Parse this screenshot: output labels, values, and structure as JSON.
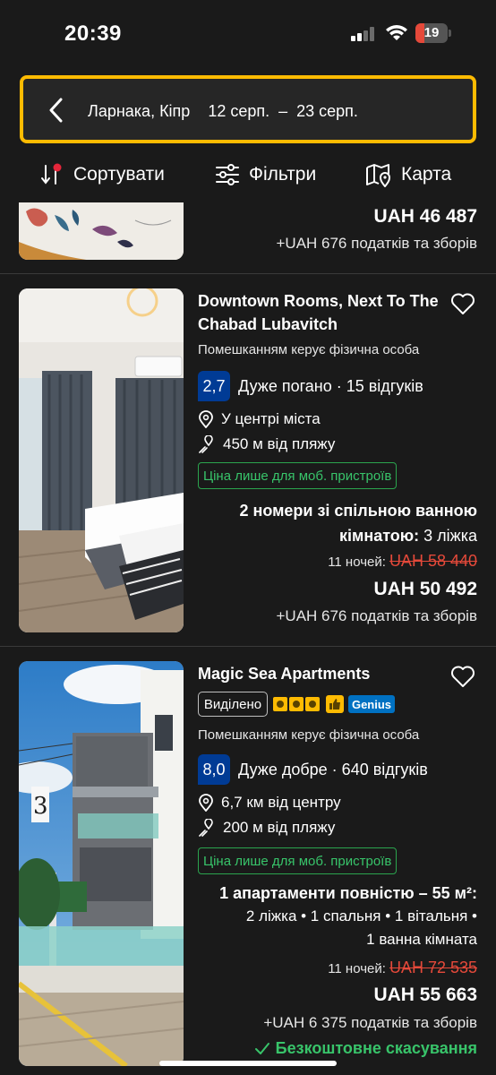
{
  "status": {
    "time": "20:39",
    "battery": "19"
  },
  "search": {
    "destination": "Ларнака, Кіпр",
    "dates": "12 серп.  –  23 серп."
  },
  "toolbar": {
    "sort": "Сортувати",
    "filters": "Фільтри",
    "map": "Карта"
  },
  "card0": {
    "price": "UAH 46 487",
    "taxes": "+UAH 676 податків та зборів"
  },
  "card1": {
    "title_line1": "Downtown Rooms, Next To The",
    "title_line2": "Chabad Lubavitch",
    "managed": "Помешканням керує фізична особа",
    "score": "2,7",
    "score_text": "Дуже погано · 15 відгуків",
    "location": "У центрі міста",
    "beach": "450 м від пляжу",
    "mobile_badge": "Ціна лише для моб. пристроїв",
    "room_line1": "2 номери зі спільною ванною",
    "room_line2_bold": "кімнатою:",
    "room_line2_normal": " 3 ліжка",
    "nights": "11 ночей:",
    "old_price": "UAH 58 440",
    "price": "UAH 50 492",
    "taxes": "+UAH 676 податків та зборів"
  },
  "card2": {
    "title": "Magic Sea Apartments",
    "featured": "Виділено",
    "genius": "Genius",
    "managed": "Помешканням керує фізична особа",
    "score": "8,0",
    "score_text": "Дуже добре · 640 відгуків",
    "location": "6,7 км від центру",
    "beach": "200 м від пляжу",
    "mobile_badge": "Ціна лише для моб. пристроїв",
    "room_line1": "1 апартаменти повністю – 55 м²:",
    "room_line2": "2 ліжка • 1 спальня • 1 вітальня •",
    "room_line3": "1 ванна кімната",
    "nights": "11 ночей:",
    "old_price": "UAH 72 535",
    "price": "UAH 55 663",
    "taxes": "+UAH 6 375 податків та зборів",
    "free_cancel": "Безкоштовне скасування",
    "building_number": "3"
  },
  "colors": {
    "accent_yellow": "#febb02",
    "score_blue": "#003b95",
    "green": "#38c46a",
    "red_strike": "#e5493a"
  },
  "icons": [
    "chevron-left-icon",
    "sort-icon",
    "filter-icon",
    "map-icon",
    "heart-icon",
    "location-pin-icon",
    "beach-pin-icon",
    "checkmark-icon"
  ]
}
